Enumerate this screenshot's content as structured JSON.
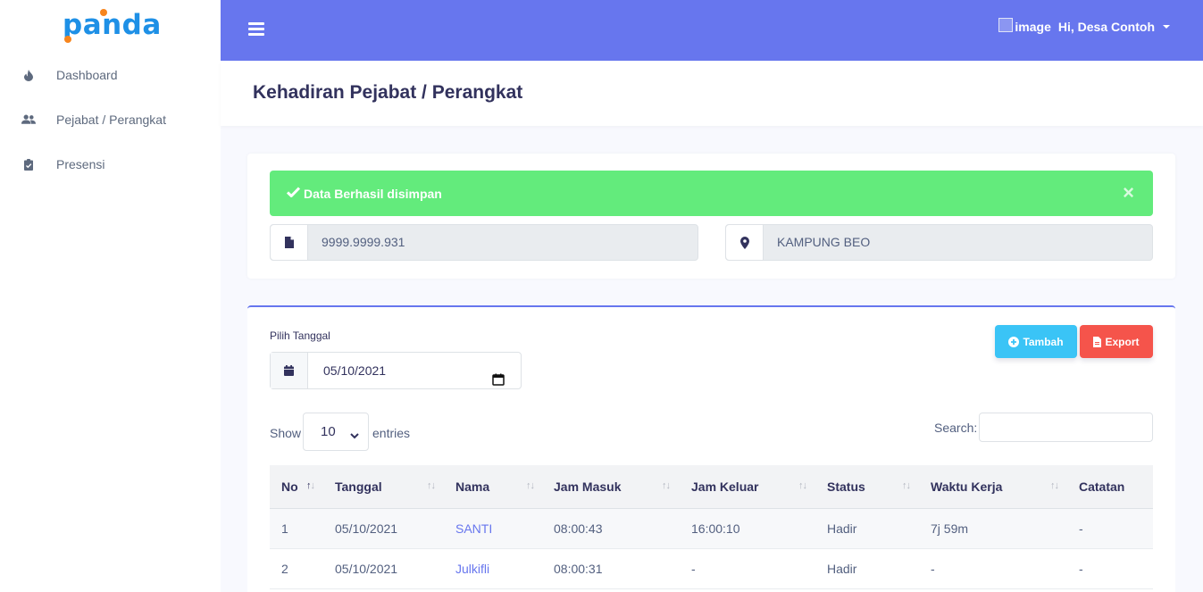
{
  "sidebar": {
    "logo": "panda",
    "items": [
      {
        "label": "Dashboard",
        "icon": "flame-icon"
      },
      {
        "label": "Pejabat / Perangkat",
        "icon": "users-icon"
      },
      {
        "label": "Presensi",
        "icon": "clipboard-check-icon"
      }
    ]
  },
  "topbar": {
    "user_image_alt": "image",
    "user_greeting": "Hi, Desa Contoh"
  },
  "header": {
    "title": "Kehadiran Pejabat / Perangkat"
  },
  "alert": {
    "message": "Data Berhasil disimpan",
    "close": "×"
  },
  "info": {
    "code": "9999.9999.931",
    "location": "KAMPUNG BEO"
  },
  "filter": {
    "label": "Pilih Tanggal",
    "date": "05/10/2021"
  },
  "actions": {
    "add_label": "Tambah",
    "export_label": "Export"
  },
  "datatable": {
    "show_label": "Show",
    "page_size": "10",
    "entries_label": "entries",
    "search_label": "Search:",
    "columns": [
      "No",
      "Tanggal",
      "Nama",
      "Jam Masuk",
      "Jam Keluar",
      "Status",
      "Waktu Kerja",
      "Catatan"
    ],
    "rows": [
      [
        "1",
        "05/10/2021",
        "SANTI",
        "08:00:43",
        "16:00:10",
        "Hadir",
        "7j 59m",
        "-"
      ],
      [
        "2",
        "05/10/2021",
        "Julkifli",
        "08:00:31",
        "-",
        "Hadir",
        "-",
        "-"
      ]
    ]
  },
  "colors": {
    "primary": "#6776ee",
    "success": "#63eb7c",
    "info": "#3ac4f6",
    "danger": "#f5544b"
  }
}
